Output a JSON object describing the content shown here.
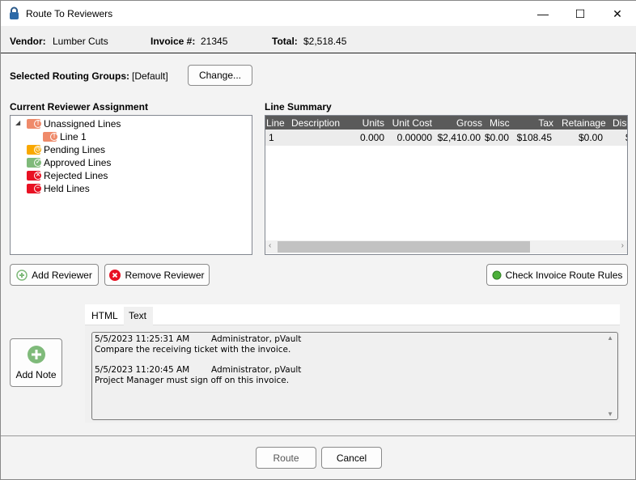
{
  "window": {
    "title": "Route To Reviewers",
    "minimize": "—",
    "maximize": "☐",
    "close": "✕"
  },
  "header": {
    "vendor_label": "Vendor:",
    "vendor": "Lumber Cuts",
    "invoice_label": "Invoice #:",
    "invoice": "21345",
    "total_label": "Total:",
    "total": "$2,518.45"
  },
  "routing": {
    "label": "Selected Routing Groups:",
    "value": "[Default]",
    "change_button": "Change..."
  },
  "assignment": {
    "title": "Current Reviewer Assignment",
    "items": [
      {
        "label": "Unassigned Lines",
        "color": "#ef8a6a",
        "icon": "warning-icon"
      },
      {
        "label": "Line 1",
        "color": "#ef8a6a",
        "icon": "warning-icon"
      },
      {
        "label": "Pending Lines",
        "color": "#f9a800",
        "icon": "clock-icon"
      },
      {
        "label": "Approved Lines",
        "color": "#7fba7a",
        "icon": "check-icon"
      },
      {
        "label": "Rejected Lines",
        "color": "#e81123",
        "icon": "x-icon"
      },
      {
        "label": "Held Lines",
        "color": "#e81123",
        "icon": "minus-icon"
      }
    ]
  },
  "line_summary": {
    "title": "Line Summary",
    "columns": [
      "Line",
      "Description",
      "Units",
      "Unit Cost",
      "Gross",
      "Misc",
      "Tax",
      "Retainage",
      "Disc"
    ],
    "rows": [
      [
        "1",
        "",
        "0.000",
        "0.00000",
        "$2,410.00",
        "$0.00",
        "$108.45",
        "$0.00",
        "$"
      ]
    ]
  },
  "buttons": {
    "add_reviewer": "Add Reviewer",
    "remove_reviewer": "Remove Reviewer",
    "check_rules": "Check Invoice Route Rules",
    "add_note": "Add Note",
    "route": "Route",
    "cancel": "Cancel"
  },
  "notes": {
    "tabs": [
      "HTML",
      "Text"
    ],
    "selected_tab": "Text",
    "entries": [
      {
        "date": "5/5/2023 11:25:31 AM",
        "author": "Administrator, pVault",
        "text": "Compare the receiving ticket with the invoice."
      },
      {
        "date": "5/5/2023 11:20:45 AM",
        "author": "Administrator, pVault",
        "text": "Project Manager must sign off on this invoice."
      }
    ]
  }
}
